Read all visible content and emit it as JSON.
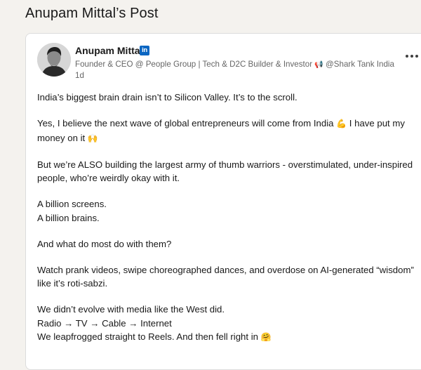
{
  "page": {
    "heading": "Anupam Mittal’s Post"
  },
  "post": {
    "author": {
      "name": "Anupam Mittal",
      "badge": "in",
      "headline": "Founder & CEO @ People Group | Tech & D2C Builder & Investor",
      "headline_icon": "megaphone-icon",
      "headline_tail": "@Shark Tank India",
      "time": "1d"
    },
    "more_label": "More actions",
    "body": {
      "p1": "India’s biggest brain drain isn’t to Silicon Valley. It’s to the scroll.",
      "p2_l1": "Yes, I believe the next wave of global entrepreneurs will come from India",
      "p2_l1_emoji": "💪",
      "p2_l1_tail": "I have put my",
      "p2_l2": "money on it",
      "p2_l2_emoji": "🙌",
      "p3_l1": "But we’re ALSO building the largest army of thumb warriors - overstimulated, under-inspired",
      "p3_l2": "people, who’re weirdly okay with it.",
      "p4_l1": "A billion screens.",
      "p4_l2": "A billion brains.",
      "p5": "And what do most do with them?",
      "p6_l1": "Watch prank videos, swipe choreographed dances, and overdose on AI-generated “wisdom”",
      "p6_l2": "like it’s roti-sabzi.",
      "p7_l1": "We didn’t evolve with media like the West did.",
      "p7_l2": "Radio → TV → Cable → Internet",
      "p7_l3": "We leapfrogged straight to Reels. And then fell right in",
      "p7_l3_emoji": "🤗"
    }
  },
  "colors": {
    "linkedin_blue": "#0a66c2",
    "muted_text": "#666666",
    "card_bg": "#ffffff",
    "page_bg": "#f4f2ee"
  }
}
